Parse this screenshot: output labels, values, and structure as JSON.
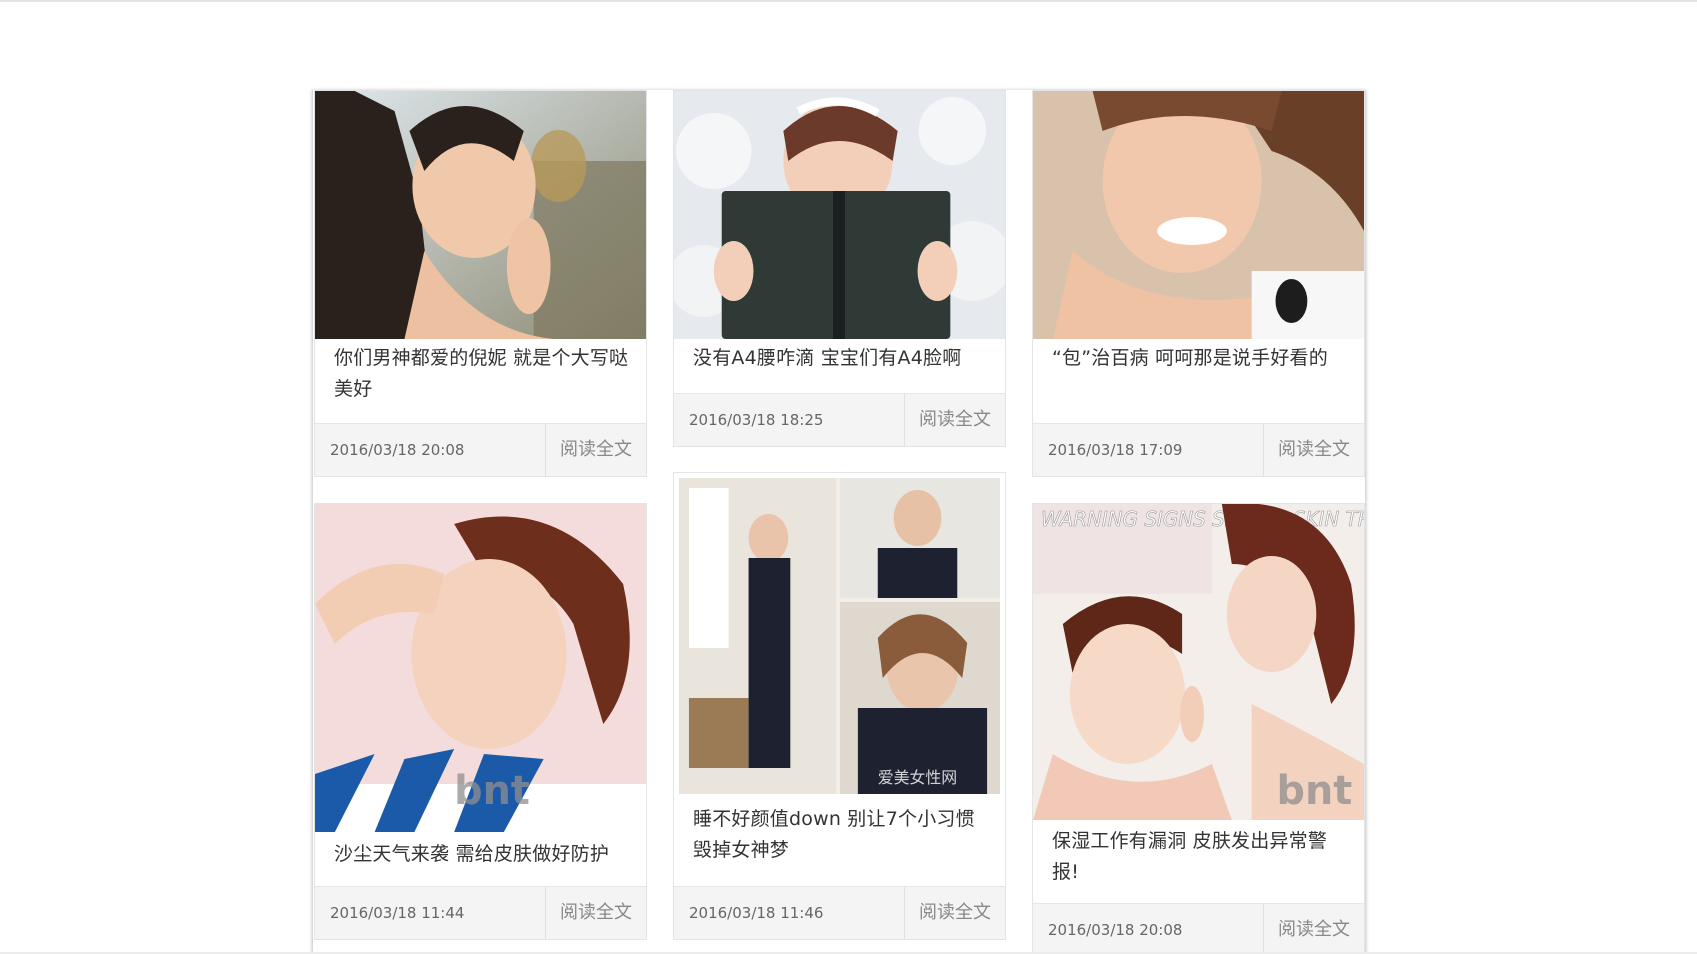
{
  "articles": [
    {
      "title": "你们男神都爱的倪妮 就是个大写哒美好",
      "date": "2016/03/18 20:08",
      "read_more": "阅读全文",
      "image": "portrait-photo"
    },
    {
      "title": "没有A4腰咋滴 宝宝们有A4脸啊",
      "date": "2016/03/18 18:25",
      "read_more": "阅读全文",
      "image": "portrait-photo-book"
    },
    {
      "title": "“包”治百病 呵呵那是说手好看的",
      "date": "2016/03/18 17:09",
      "read_more": "阅读全文",
      "image": "portrait-photo-smile"
    },
    {
      "title": "沙尘天气来袭 需给皮肤做好防护",
      "date": "2016/03/18 11:44",
      "read_more": "阅读全文",
      "image": "portrait-photo-bnt",
      "image_text": "bnt"
    },
    {
      "title": "睡不好颜值down 别让7个小习惯毁掉女神梦",
      "date": "2016/03/18 11:46",
      "read_more": "阅读全文",
      "image": "collage-photo",
      "image_text": "爱美女性网"
    },
    {
      "title": "保湿工作有漏洞 皮肤发出异常警报!",
      "date": "2016/03/18 20:08",
      "read_more": "阅读全文",
      "image": "portrait-photo-duo",
      "image_text": "WARNING SIGNS SPRING SKIN TROUBLES"
    }
  ],
  "colors": {
    "footer_bg": "#f4f4f4",
    "border": "#e4e4e4",
    "title_text": "#333333",
    "meta_text": "#666666"
  }
}
